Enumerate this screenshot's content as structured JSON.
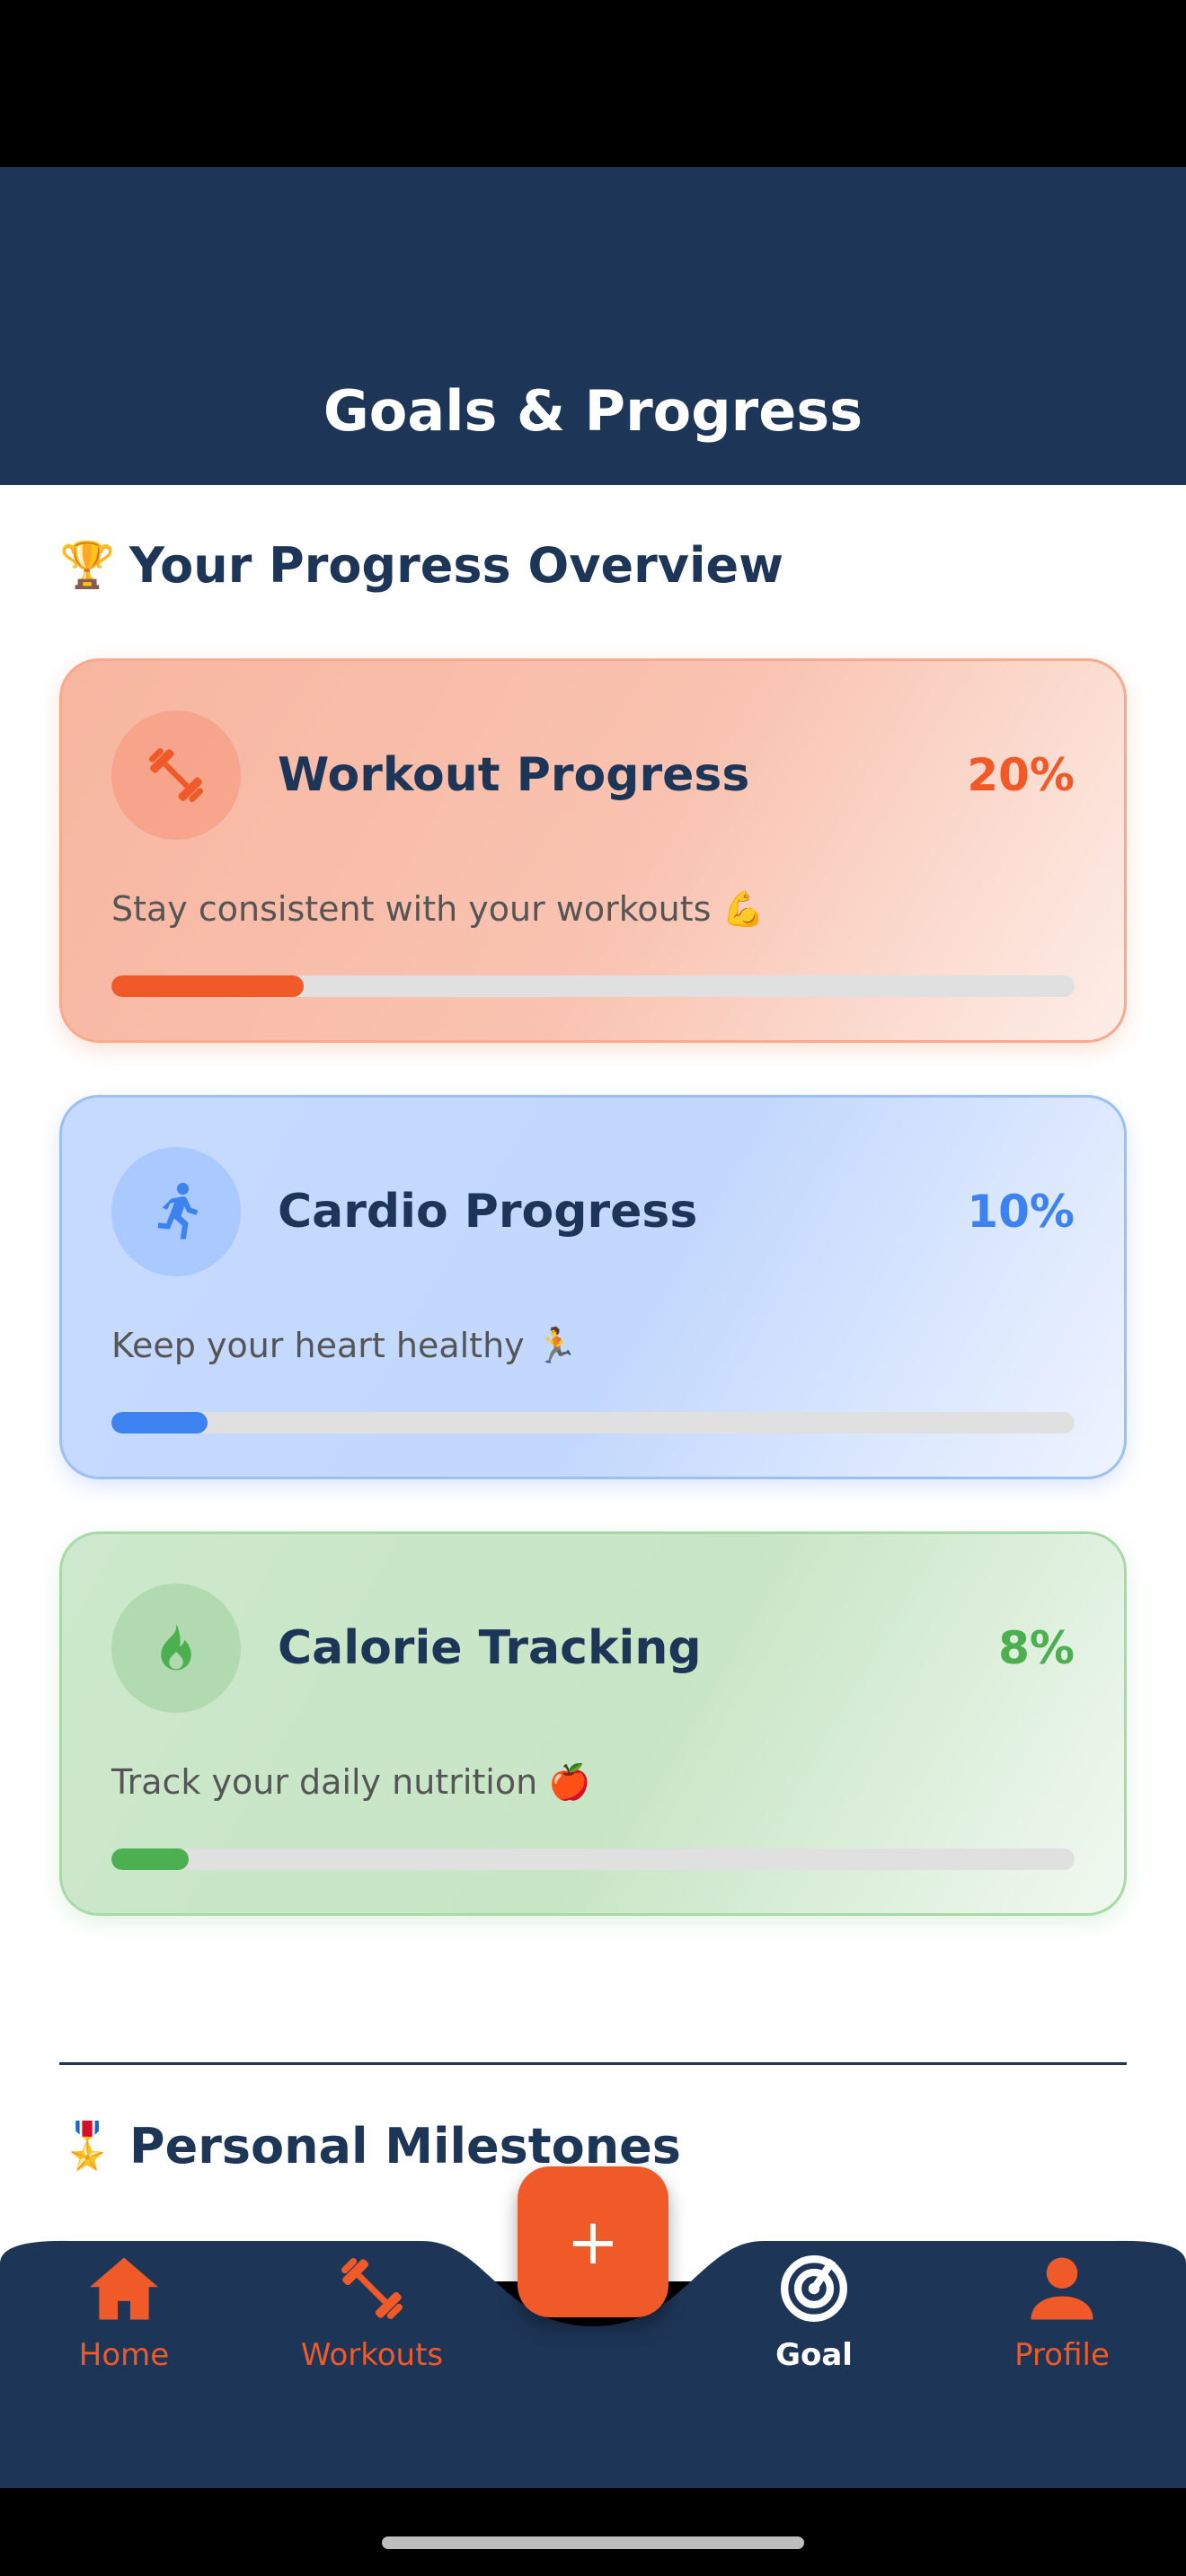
{
  "header": {
    "title": "Goals & Progress"
  },
  "overview": {
    "emoji": "🏆",
    "title": "Your Progress Overview",
    "cards": [
      {
        "title": "Workout Progress",
        "percent_label": "20%",
        "progress": 0.2,
        "subtitle": "Stay consistent with your workouts 💪",
        "icon": "dumbbell-icon",
        "color": "#f05a28"
      },
      {
        "title": "Cardio Progress",
        "percent_label": "10%",
        "progress": 0.1,
        "subtitle": "Keep your heart healthy 🏃",
        "icon": "runner-icon",
        "color": "#3c82f0"
      },
      {
        "title": "Calorie Tracking",
        "percent_label": "8%",
        "progress": 0.08,
        "subtitle": "Track your daily nutrition 🍎",
        "icon": "flame-icon",
        "color": "#4caf50"
      }
    ]
  },
  "milestones": {
    "emoji": "🎖️",
    "title": "Personal Milestones"
  },
  "fab": {
    "label": "+"
  },
  "nav": {
    "items": [
      {
        "label": "Home",
        "icon": "home-icon",
        "active": false
      },
      {
        "label": "Workouts",
        "icon": "dumbbell-icon",
        "active": false
      },
      {
        "label": "Goal",
        "icon": "target-icon",
        "active": true
      },
      {
        "label": "Profile",
        "icon": "person-icon",
        "active": false
      }
    ]
  },
  "colors": {
    "primary": "#1d3557",
    "accent": "#f05a28"
  }
}
